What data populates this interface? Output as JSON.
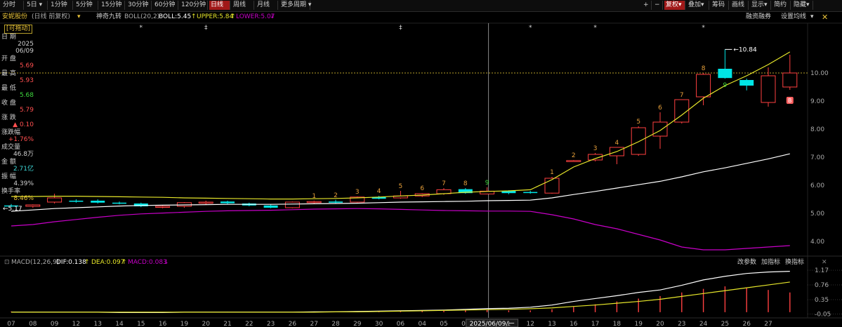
{
  "toolbar": {
    "left_buttons": [
      "分时",
      "5日",
      "1分钟",
      "5分钟",
      "15分钟",
      "30分钟",
      "60分钟",
      "120分钟",
      "日线",
      "周线",
      "月线",
      "更多周期"
    ],
    "active": "日线",
    "right_buttons": [
      "+",
      "−",
      "复权",
      "叠加",
      "筹码",
      "画线",
      "显示",
      "简约",
      "隐藏"
    ],
    "right_active": "复权"
  },
  "infobar": {
    "stock_name": "安妮股份",
    "period_note": "(日线 前复权)",
    "indicator1": "神奇九转",
    "boll": "BOLL(20,2)",
    "boll_mid": "BOLL:5.45",
    "upper": "UPPER:5.84",
    "lower": "LOWER:5.07",
    "margin_label": "融资融券",
    "settings_label": "设置均线"
  },
  "side": {
    "drag_label": "[可拖动]",
    "rows": [
      {
        "label": "日  期",
        "value": "2025",
        "color": "#cfcfcf"
      },
      {
        "label": "",
        "value": "06/09",
        "color": "#cfcfcf"
      },
      {
        "label": "开  盘",
        "value": "5.69",
        "color": "#ff5050"
      },
      {
        "label": "最  高",
        "value": "5.93",
        "color": "#ff5050"
      },
      {
        "label": "最  低",
        "value": "5.68",
        "color": "#3ed83e"
      },
      {
        "label": "收  盘",
        "value": "5.79",
        "color": "#ff5050"
      },
      {
        "label": "涨  跌",
        "value": "▲ 0.10",
        "color": "#ff5050"
      },
      {
        "label": "涨跌幅",
        "value": "+1.76%",
        "color": "#ff5050"
      },
      {
        "label": "成交量",
        "value": "46.8万",
        "color": "#cfcfcf"
      },
      {
        "label": "金  额",
        "value": "2.71亿",
        "color": "#3ed8d8"
      },
      {
        "label": "振  幅",
        "value": "4.39%",
        "color": "#cfcfcf"
      },
      {
        "label": "换手率",
        "value": "8.46%",
        "color": "#e8c23a"
      }
    ]
  },
  "price_axis": {
    "labels": [
      "10.00",
      "9.00",
      "8.00",
      "7.00",
      "6.00",
      "5.00",
      "4.00"
    ]
  },
  "price_markers": {
    "current_line": "10.00",
    "high_label": "10.84",
    "low_label": "5.17"
  },
  "nine_turn_labels": [
    "1",
    "2",
    "3",
    "4",
    "5",
    "6",
    "7",
    "8",
    "9",
    "1",
    "2",
    "3",
    "4",
    "5",
    "6",
    "7",
    "8",
    "9"
  ],
  "macd": {
    "title": "MACD(12,26,9)",
    "dif": "DIF:0.138",
    "dea": "DEA:0.097",
    "macd": "MACD:0.083",
    "buttons": [
      "改参数",
      "加指标",
      "换指标"
    ],
    "axis": [
      "1.17",
      "0.76",
      "0.35",
      "-0.05"
    ]
  },
  "date_axis": {
    "labels": [
      "07",
      "08",
      "09",
      "12",
      "13",
      "14",
      "15",
      "16",
      "19",
      "20",
      "21",
      "22",
      "23",
      "26",
      "27",
      "28",
      "29",
      "30",
      "06",
      "04",
      "05",
      "06",
      "2025/06/09/一",
      "1",
      "12",
      "13",
      "16",
      "17",
      "18",
      "19",
      "20",
      "23",
      "24",
      "25",
      "26",
      "27"
    ]
  },
  "chart_data": {
    "type": "candlestick",
    "candles": [
      {
        "o": 5.28,
        "h": 5.33,
        "l": 5.22,
        "c": 5.25
      },
      {
        "o": 5.25,
        "h": 5.32,
        "l": 5.2,
        "c": 5.3
      },
      {
        "o": 5.4,
        "h": 5.7,
        "l": 5.35,
        "c": 5.55
      },
      {
        "o": 5.45,
        "h": 5.5,
        "l": 5.38,
        "c": 5.42
      },
      {
        "o": 5.45,
        "h": 5.5,
        "l": 5.35,
        "c": 5.38
      },
      {
        "o": 5.38,
        "h": 5.42,
        "l": 5.32,
        "c": 5.36
      },
      {
        "o": 5.35,
        "h": 5.38,
        "l": 5.22,
        "c": 5.25
      },
      {
        "o": 5.22,
        "h": 5.28,
        "l": 5.18,
        "c": 5.25
      },
      {
        "o": 5.25,
        "h": 5.4,
        "l": 5.2,
        "c": 5.38
      },
      {
        "o": 5.38,
        "h": 5.45,
        "l": 5.32,
        "c": 5.4
      },
      {
        "o": 5.42,
        "h": 5.45,
        "l": 5.33,
        "c": 5.36
      },
      {
        "o": 5.35,
        "h": 5.38,
        "l": 5.25,
        "c": 5.28
      },
      {
        "o": 5.28,
        "h": 5.32,
        "l": 5.18,
        "c": 5.2
      },
      {
        "o": 5.2,
        "h": 5.42,
        "l": 5.18,
        "c": 5.4
      },
      {
        "o": 5.4,
        "h": 5.45,
        "l": 5.35,
        "c": 5.42
      },
      {
        "o": 5.42,
        "h": 5.48,
        "l": 5.35,
        "c": 5.38
      },
      {
        "o": 5.4,
        "h": 5.6,
        "l": 5.38,
        "c": 5.58
      },
      {
        "o": 5.58,
        "h": 5.62,
        "l": 5.5,
        "c": 5.52
      },
      {
        "o": 5.55,
        "h": 5.8,
        "l": 5.52,
        "c": 5.62
      },
      {
        "o": 5.62,
        "h": 5.72,
        "l": 5.58,
        "c": 5.7
      },
      {
        "o": 5.7,
        "h": 5.9,
        "l": 5.66,
        "c": 5.84
      },
      {
        "o": 5.86,
        "h": 5.9,
        "l": 5.7,
        "c": 5.72
      },
      {
        "o": 5.69,
        "h": 5.93,
        "l": 5.68,
        "c": 5.79
      },
      {
        "o": 5.8,
        "h": 5.82,
        "l": 5.68,
        "c": 5.72
      },
      {
        "o": 5.76,
        "h": 5.8,
        "l": 5.7,
        "c": 5.74
      },
      {
        "o": 5.72,
        "h": 6.3,
        "l": 5.7,
        "c": 6.25
      },
      {
        "o": 6.88,
        "h": 6.9,
        "l": 6.85,
        "c": 6.88
      },
      {
        "o": 6.9,
        "h": 7.15,
        "l": 6.85,
        "c": 7.1
      },
      {
        "o": 7.05,
        "h": 7.35,
        "l": 6.75,
        "c": 7.35
      },
      {
        "o": 7.1,
        "h": 8.1,
        "l": 7.05,
        "c": 8.05
      },
      {
        "o": 7.75,
        "h": 8.6,
        "l": 7.3,
        "c": 8.25
      },
      {
        "o": 8.25,
        "h": 9.05,
        "l": 8.2,
        "c": 9.05
      },
      {
        "o": 9.15,
        "h": 10.0,
        "l": 8.85,
        "c": 9.95
      },
      {
        "o": 10.15,
        "h": 10.84,
        "l": 9.8,
        "c": 9.82
      },
      {
        "o": 9.75,
        "h": 9.8,
        "l": 9.38,
        "c": 9.55
      },
      {
        "o": 8.95,
        "h": 10.2,
        "l": 8.8,
        "c": 9.9
      },
      {
        "o": 9.5,
        "h": 10.65,
        "l": 9.4,
        "c": 10.0
      }
    ],
    "boll_upper": [
      5.6,
      5.6,
      5.61,
      5.61,
      5.6,
      5.59,
      5.58,
      5.57,
      5.55,
      5.54,
      5.53,
      5.52,
      5.51,
      5.51,
      5.52,
      5.53,
      5.55,
      5.58,
      5.62,
      5.65,
      5.7,
      5.75,
      5.78,
      5.8,
      5.84,
      6.2,
      6.65,
      6.95,
      7.2,
      7.55,
      7.95,
      8.5,
      9.1,
      9.55,
      9.9,
      10.3,
      10.75
    ],
    "boll_mid": [
      5.07,
      5.12,
      5.17,
      5.2,
      5.23,
      5.26,
      5.28,
      5.29,
      5.3,
      5.31,
      5.32,
      5.32,
      5.32,
      5.33,
      5.34,
      5.35,
      5.36,
      5.38,
      5.4,
      5.41,
      5.42,
      5.43,
      5.45,
      5.46,
      5.47,
      5.55,
      5.67,
      5.78,
      5.9,
      6.02,
      6.14,
      6.3,
      6.48,
      6.62,
      6.78,
      6.94,
      7.12
    ],
    "boll_lower": [
      4.55,
      4.6,
      4.7,
      4.78,
      4.86,
      4.93,
      4.98,
      5.01,
      5.04,
      5.07,
      5.09,
      5.1,
      5.11,
      5.13,
      5.15,
      5.16,
      5.17,
      5.16,
      5.14,
      5.12,
      5.1,
      5.09,
      5.08,
      5.08,
      5.07,
      4.95,
      4.8,
      4.6,
      4.45,
      4.25,
      4.05,
      3.8,
      3.7,
      3.7,
      3.75,
      3.8,
      3.85
    ],
    "price_ylim": [
      3.55,
      11.7
    ],
    "macd_hist": [
      0.02,
      0.01,
      0.0,
      -0.01,
      -0.01,
      -0.01,
      -0.01,
      0.0,
      0.0,
      0.01,
      0.01,
      0.01,
      0.0,
      0.0,
      0.01,
      0.01,
      0.02,
      0.02,
      0.03,
      0.03,
      0.04,
      0.05,
      0.06,
      0.05,
      0.05,
      0.08,
      0.15,
      0.22,
      0.3,
      0.38,
      0.45,
      0.55,
      0.65,
      0.72,
      0.68,
      0.62,
      0.55
    ],
    "dif": [
      0.0,
      0.0,
      0.0,
      0.0,
      0.0,
      -0.01,
      -0.01,
      -0.01,
      0.0,
      0.0,
      0.0,
      0.0,
      0.0,
      0.0,
      0.01,
      0.01,
      0.02,
      0.03,
      0.04,
      0.05,
      0.06,
      0.08,
      0.1,
      0.11,
      0.138,
      0.2,
      0.3,
      0.38,
      0.46,
      0.55,
      0.62,
      0.75,
      0.9,
      1.0,
      1.08,
      1.12,
      1.14
    ],
    "dea": [
      0.0,
      0.0,
      0.0,
      0.0,
      0.0,
      0.0,
      0.0,
      0.0,
      0.0,
      0.0,
      0.0,
      0.0,
      0.0,
      0.0,
      0.0,
      0.01,
      0.01,
      0.02,
      0.03,
      0.04,
      0.05,
      0.06,
      0.07,
      0.08,
      0.097,
      0.12,
      0.16,
      0.2,
      0.25,
      0.3,
      0.36,
      0.44,
      0.52,
      0.6,
      0.68,
      0.76,
      0.84
    ],
    "macd_ylim": [
      -0.1,
      1.25
    ]
  },
  "colors": {
    "up": "#ff4040",
    "down": "#00e5e5",
    "boll_upper": "#e6e62a",
    "boll_mid": "#ffffff",
    "boll_lower": "#c800c8",
    "nine_up": "#e8a03a",
    "nine_green": "#3ed83e"
  }
}
